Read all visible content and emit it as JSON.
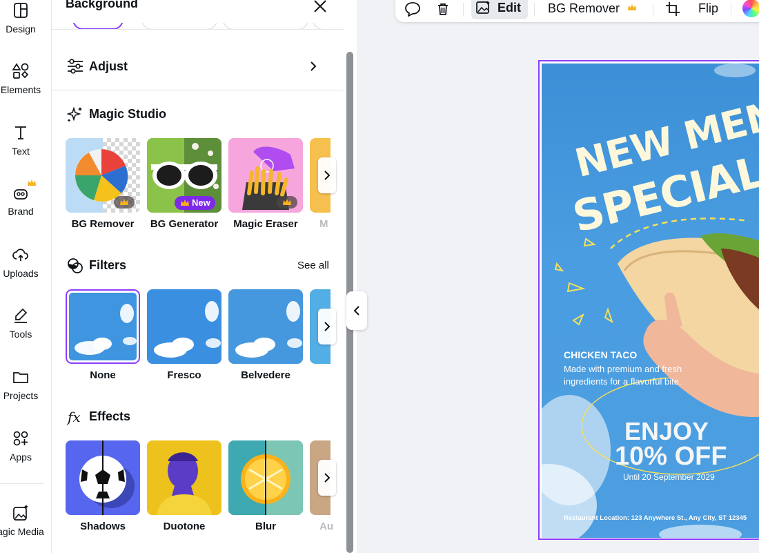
{
  "rail": {
    "items": [
      {
        "label": "Design",
        "icon": "design-icon"
      },
      {
        "label": "Elements",
        "icon": "elements-icon"
      },
      {
        "label": "Text",
        "icon": "text-icon"
      },
      {
        "label": "Brand",
        "icon": "brand-icon"
      },
      {
        "label": "Uploads",
        "icon": "uploads-icon"
      },
      {
        "label": "Tools",
        "icon": "tools-icon"
      },
      {
        "label": "Projects",
        "icon": "projects-icon"
      },
      {
        "label": "Apps",
        "icon": "apps-icon"
      },
      {
        "label": "agic Media",
        "icon": "magic-media-icon"
      }
    ]
  },
  "panel": {
    "title": "Background",
    "adjust": {
      "label": "Adjust"
    },
    "magic_studio": {
      "title": "Magic Studio",
      "tools": [
        {
          "label": "BG Remover"
        },
        {
          "label": "BG Generator",
          "badge": "New"
        },
        {
          "label": "Magic Eraser"
        },
        {
          "label": "M"
        }
      ]
    },
    "filters": {
      "title": "Filters",
      "see_all": "See all",
      "items": [
        {
          "label": "None",
          "selected": true
        },
        {
          "label": "Fresco"
        },
        {
          "label": "Belvedere"
        }
      ]
    },
    "effects": {
      "title": "Effects",
      "items": [
        {
          "label": "Shadows"
        },
        {
          "label": "Duotone"
        },
        {
          "label": "Blur"
        },
        {
          "label": "Au"
        }
      ]
    }
  },
  "toolbar": {
    "edit": "Edit",
    "bg_remover": "BG Remover",
    "flip": "Flip"
  },
  "design": {
    "headline_1": "NEW MENU",
    "headline_2": "SPECIAL PR",
    "item_name": "CHICKEN TACO",
    "item_desc_1": "Made with premium and fresh",
    "item_desc_2": "ingredients for a flavorful bite.",
    "offer_1": "ENJOY",
    "offer_2": "10% OFF",
    "offer_until": "Until 20 September 2029",
    "location": "Restaurant Location: 123 Anywhere St., Any City, ST 12345"
  },
  "colors": {
    "accent": "#8b3dff",
    "poster_blue": "#4a9de0",
    "headline_cream": "#fdf7dc"
  }
}
